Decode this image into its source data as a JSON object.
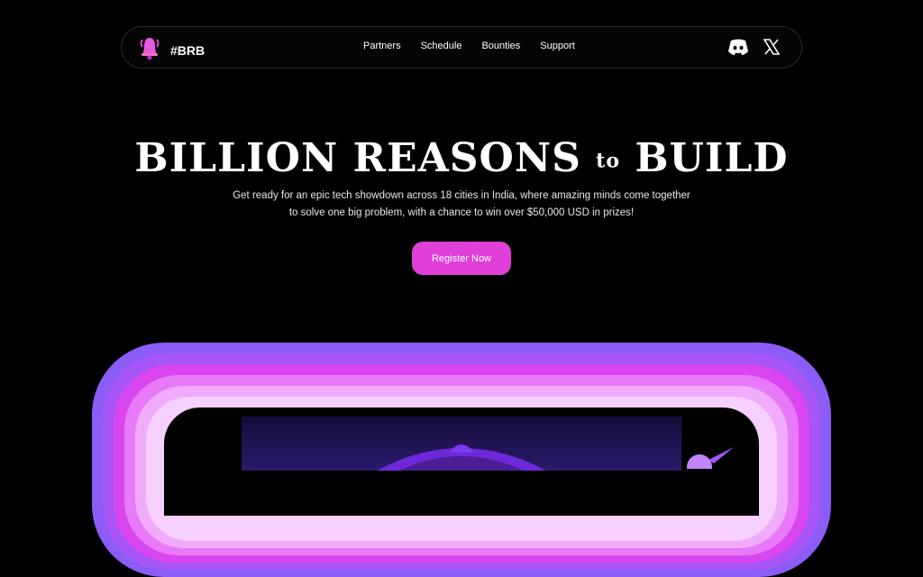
{
  "nav": {
    "brand": "#BRB",
    "links": [
      "Partners",
      "Schedule",
      "Bounties",
      "Support"
    ],
    "social_icons": [
      "discord-icon",
      "x-icon"
    ]
  },
  "hero": {
    "title_part1": "BILLION REASONS",
    "title_to": "to",
    "title_part2": "BUILD",
    "description": "Get ready for an epic tech showdown across 18 cities in India, where amazing minds come together to solve one big problem, with a chance to win over $50,000 USD in prizes!",
    "cta": "Register Now"
  },
  "colors": {
    "accent": "#e040d8",
    "background": "#000000",
    "frame_outer": "#8b5cf6",
    "frame_inner": "#f5d0fe"
  }
}
